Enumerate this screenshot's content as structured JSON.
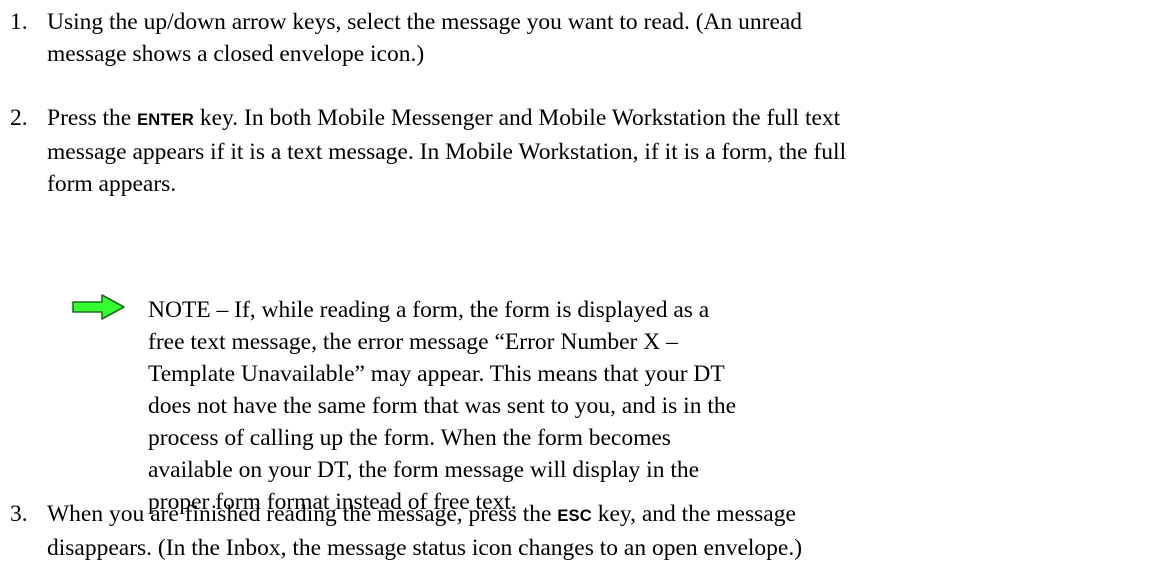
{
  "steps": [
    {
      "number": "1.",
      "lines": [
        "Using the up/down arrow keys, select the message you want to read. (An unread",
        "message shows a closed envelope icon.)"
      ]
    },
    {
      "number": "2.",
      "line1_pre": "Press the ",
      "key": "ENTER",
      "line1_post": " key. In both Mobile Messenger and Mobile Workstation the full text",
      "lines": [
        "message appears if it is a text message. In Mobile Workstation, if it is a form, the full",
        "form appears."
      ]
    },
    {
      "number": "3.",
      "line1_pre": "When you are finished reading the message, press the ",
      "key": "ESC",
      "line1_post": " key, and the message",
      "lines": [
        "disappears. (In the Inbox, the message status icon changes to an open envelope.)"
      ]
    }
  ],
  "note": {
    "icon": "right-arrow-icon",
    "arrow_color": "#33ff33",
    "lines": [
      "NOTE – If, while reading a form, the form is displayed as a",
      "free text message, the error message “Error Number X –",
      "Template Unavailable” may appear. This means that your DT",
      "does not have the same form that was sent to you, and is in the",
      "process of calling up the form. When the form becomes",
      "available on your DT, the form message will display in the",
      "proper form format instead of free text."
    ]
  }
}
